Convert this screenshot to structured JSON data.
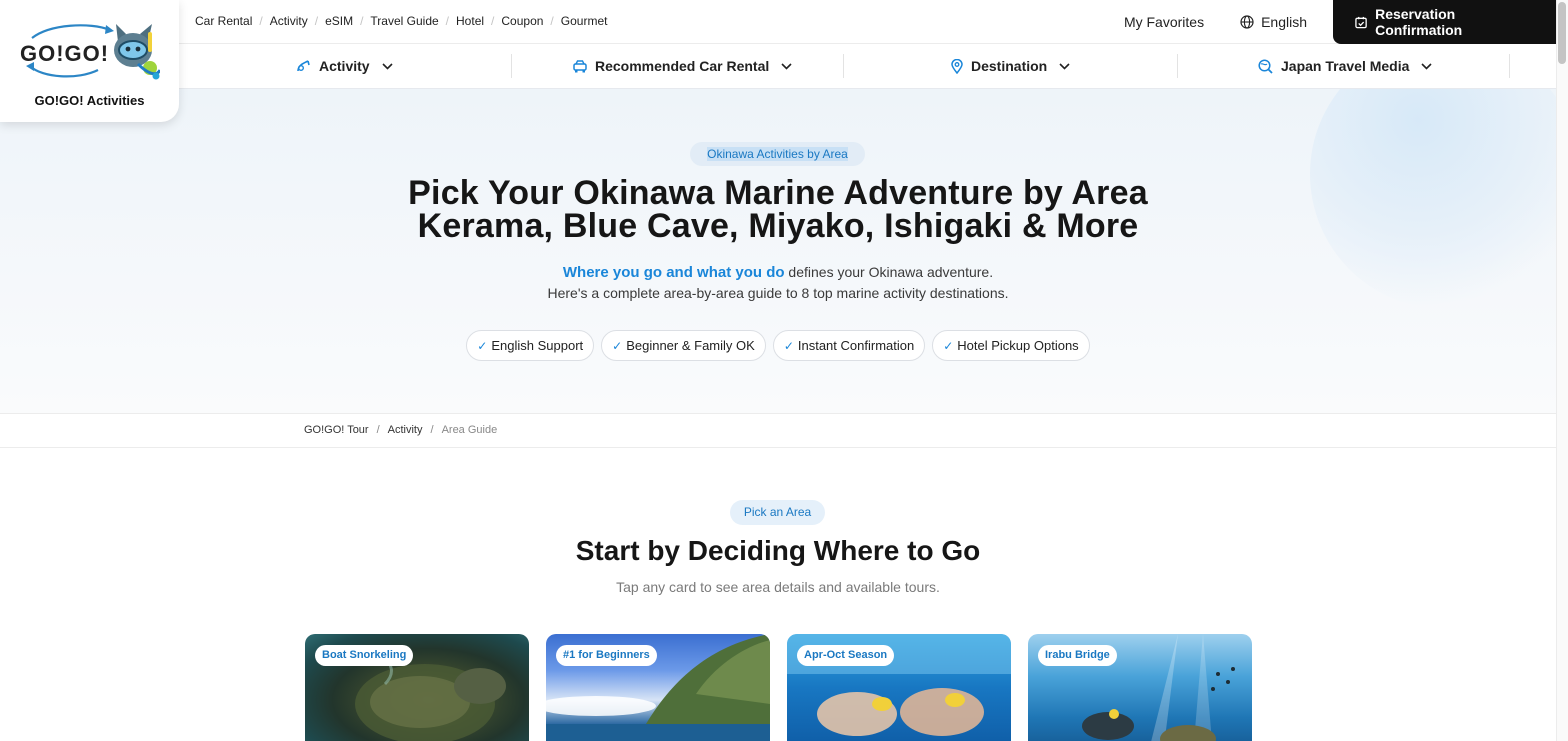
{
  "topbar": {
    "links": [
      "Car Rental",
      "Activity",
      "eSIM",
      "Travel Guide",
      "Hotel",
      "Coupon",
      "Gourmet"
    ],
    "favorites": "My Favorites",
    "language": "English",
    "reservation": "Reservation Confirmation"
  },
  "logo": {
    "wordmark": "GO!GO!",
    "name": "GO!GO! Activities"
  },
  "nav": {
    "items": [
      {
        "label": "Activity",
        "icon": "snorkel-icon"
      },
      {
        "label": "Recommended Car Rental",
        "icon": "car-icon"
      },
      {
        "label": "Destination",
        "icon": "map-pin-icon"
      },
      {
        "label": "Japan Travel Media",
        "icon": "globe-search-icon"
      }
    ]
  },
  "hero": {
    "pill": "Okinawa Activities by Area",
    "title_line1": "Pick Your Okinawa Marine Adventure by Area",
    "title_line2": "Kerama, Blue Cave, Miyako, Ishigaki & More",
    "sub_highlight": "Where you go and what you do",
    "sub_rest": " defines your Okinawa adventure.",
    "sub_line2": "Here's a complete area-by-area guide to 8 top marine activity destinations.",
    "chips": [
      "English Support",
      "Beginner & Family OK",
      "Instant Confirmation",
      "Hotel Pickup Options"
    ]
  },
  "breadcrumb": {
    "items": [
      "GO!GO! Tour",
      "Activity",
      "Area Guide"
    ]
  },
  "section": {
    "pill": "Pick an Area",
    "title": "Start by Deciding Where to Go",
    "subtitle": "Tap any card to see area details and available tours."
  },
  "cards": [
    {
      "tag": "Boat Snorkeling"
    },
    {
      "tag": "#1 for Beginners"
    },
    {
      "tag": "Apr-Oct Season"
    },
    {
      "tag": "Irabu Bridge"
    }
  ],
  "colors": {
    "accent": "#1a86d9",
    "dark_button": "#111111",
    "hero_bg": "#eef4f9"
  }
}
